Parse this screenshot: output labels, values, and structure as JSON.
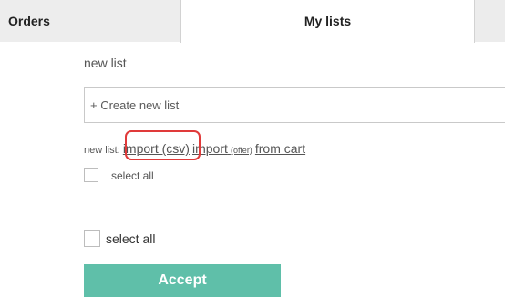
{
  "tabs": {
    "orders": "Orders",
    "my_lists": "My lists"
  },
  "section": {
    "title": "new list"
  },
  "create_list": {
    "placeholder": "+ Create new list"
  },
  "actions": {
    "prefix": "new list:",
    "import_csv": "import (csv)",
    "import_label": "import",
    "import_offer_suffix": "(offer)",
    "from_cart": "from cart"
  },
  "select_all_top": "select all",
  "select_all_bottom": "select all",
  "accept_button": "Accept",
  "colors": {
    "accent": "#5fbfa9",
    "highlight": "#e03a3a"
  }
}
